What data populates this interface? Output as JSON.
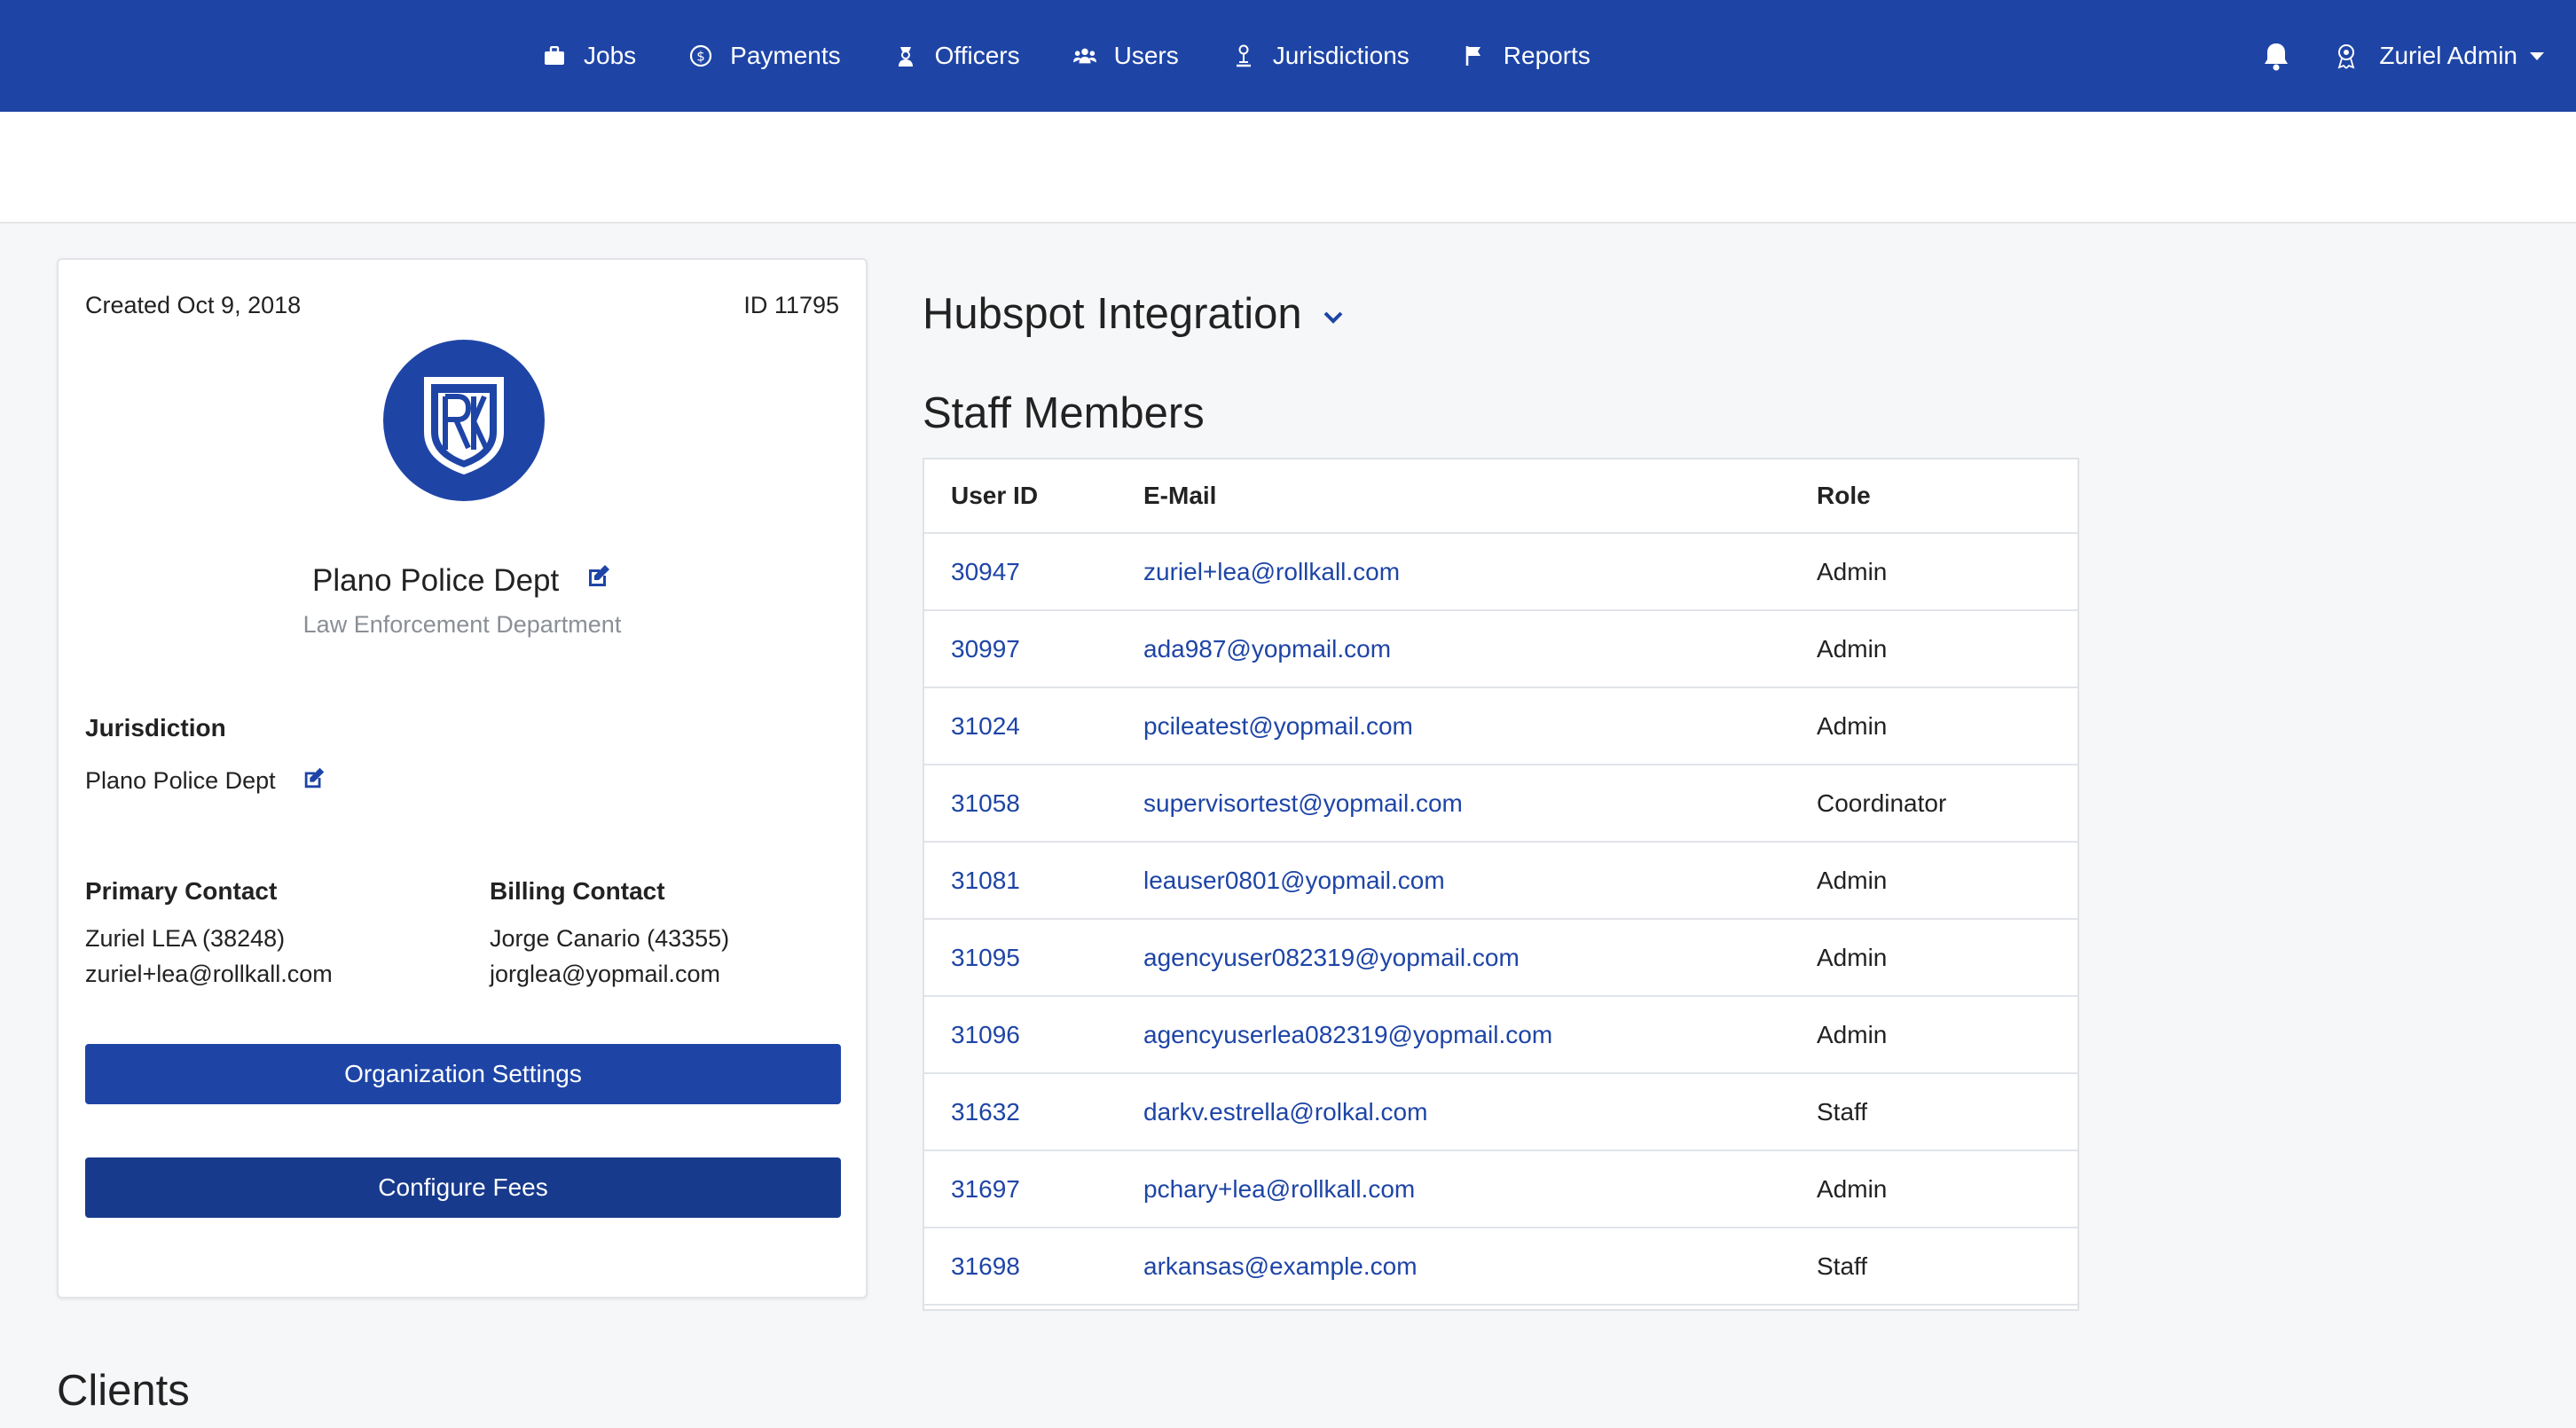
{
  "nav": {
    "items": [
      {
        "label": "Jobs",
        "icon": "briefcase-icon"
      },
      {
        "label": "Payments",
        "icon": "dollar-circle-icon"
      },
      {
        "label": "Officers",
        "icon": "officer-icon"
      },
      {
        "label": "Users",
        "icon": "users-icon"
      },
      {
        "label": "Jurisdictions",
        "icon": "jurisdiction-icon"
      },
      {
        "label": "Reports",
        "icon": "flag-icon"
      }
    ],
    "user_label": "Zuriel Admin"
  },
  "org_card": {
    "created": "Created Oct 9, 2018",
    "id_label": "ID 11795",
    "name": "Plano Police Dept",
    "type": "Law Enforcement Department",
    "jurisdiction_heading": "Jurisdiction",
    "jurisdiction_value": "Plano Police Dept",
    "primary_contact_heading": "Primary Contact",
    "primary_contact_name": "Zuriel LEA (38248)",
    "primary_contact_email": "zuriel+lea@rollkall.com",
    "billing_contact_heading": "Billing Contact",
    "billing_contact_name": "Jorge Canario (43355)",
    "billing_contact_email": "jorglea@yopmail.com",
    "org_settings_button": "Organization Settings",
    "configure_fees_button": "Configure Fees"
  },
  "main": {
    "hubspot_title": "Hubspot Integration",
    "staff_title": "Staff Members",
    "columns": [
      "User ID",
      "E-Mail",
      "Role"
    ],
    "rows": [
      {
        "id": "30947",
        "email": "zuriel+lea@rollkall.com",
        "role": "Admin"
      },
      {
        "id": "30997",
        "email": "ada987@yopmail.com",
        "role": "Admin"
      },
      {
        "id": "31024",
        "email": "pcileatest@yopmail.com",
        "role": "Admin"
      },
      {
        "id": "31058",
        "email": "supervisortest@yopmail.com",
        "role": "Coordinator"
      },
      {
        "id": "31081",
        "email": "leauser0801@yopmail.com",
        "role": "Admin"
      },
      {
        "id": "31095",
        "email": "agencyuser082319@yopmail.com",
        "role": "Admin"
      },
      {
        "id": "31096",
        "email": "agencyuserlea082319@yopmail.com",
        "role": "Admin"
      },
      {
        "id": "31632",
        "email": "darkv.estrella@rolkal.com",
        "role": "Staff"
      },
      {
        "id": "31697",
        "email": "pchary+lea@rollkall.com",
        "role": "Admin"
      },
      {
        "id": "31698",
        "email": "arkansas@example.com",
        "role": "Staff"
      }
    ],
    "clients_title": "Clients"
  },
  "colors": {
    "brand": "#1e45a6",
    "brand_dark": "#183a8d",
    "muted": "#8a8f96"
  }
}
